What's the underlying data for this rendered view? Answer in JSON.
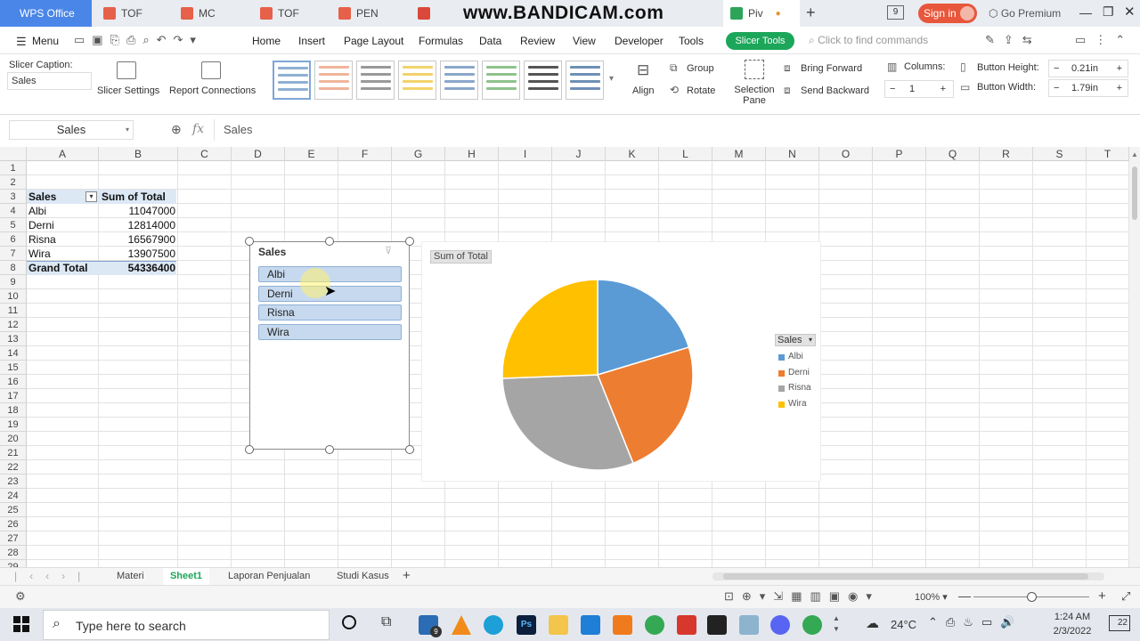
{
  "watermark": "www.BANDICAM.com",
  "tabs": {
    "wps": "WPS Office",
    "docs": [
      "TOF",
      "MC",
      "TOF",
      "PEN",
      "",
      "Piv"
    ],
    "active": "Piv",
    "sign_in": "Sign in",
    "premium": "Go Premium",
    "badge": "9"
  },
  "menu": {
    "menu_label": "Menu",
    "items": [
      "Home",
      "Insert",
      "Page Layout",
      "Formulas",
      "Data",
      "Review",
      "View",
      "Developer",
      "Tools"
    ],
    "active_tool": "Slicer Tools",
    "search_placeholder": "Click to find commands"
  },
  "ribbon": {
    "caption_label": "Slicer Caption:",
    "caption_value": "Sales",
    "slicer_settings": "Slicer Settings",
    "report_connections": "Report Connections",
    "align": "Align",
    "group": "Group",
    "rotate": "Rotate",
    "selection_pane": "Selection Pane",
    "bring_forward": "Bring Forward",
    "send_backward": "Send Backward",
    "columns_label": "Columns:",
    "columns_value": "1",
    "button_height_label": "Button Height:",
    "button_height_value": "0.21in",
    "button_width_label": "Button Width:",
    "button_width_value": "1.79in"
  },
  "formula_bar": {
    "name_box": "Sales",
    "fx": "fx",
    "content": "Sales"
  },
  "columns": [
    "A",
    "B",
    "C",
    "D",
    "E",
    "F",
    "G",
    "H",
    "I",
    "J",
    "K",
    "L",
    "M",
    "N",
    "O",
    "P",
    "Q",
    "R",
    "S",
    "T"
  ],
  "rows": [
    "1",
    "2",
    "3",
    "4",
    "5",
    "6",
    "7",
    "8",
    "9",
    "10",
    "11",
    "12",
    "13",
    "14",
    "15",
    "16",
    "17",
    "18",
    "19",
    "20",
    "21",
    "22",
    "23",
    "24",
    "25",
    "26",
    "27",
    "28",
    "29"
  ],
  "pivot": {
    "header_a": "Sales",
    "header_b": "Sum of Total",
    "rows": [
      {
        "name": "Albi",
        "value": "11047000"
      },
      {
        "name": "Derni",
        "value": "12814000"
      },
      {
        "name": "Risna",
        "value": "16567900"
      },
      {
        "name": "Wira",
        "value": "13907500"
      }
    ],
    "total_label": "Grand Total",
    "total_value": "54336400"
  },
  "slicer": {
    "title": "Sales",
    "items": [
      "Albi",
      "Derni",
      "Risna",
      "Wira"
    ]
  },
  "chart_data": {
    "type": "pie",
    "title": "",
    "field_button": "Sum of Total",
    "legend_title": "Sales",
    "legend_position": "right",
    "categories": [
      "Albi",
      "Derni",
      "Risna",
      "Wira"
    ],
    "values": [
      11047000,
      12814000,
      16567900,
      13907500
    ],
    "colors": [
      "#5b9bd5",
      "#ed7d31",
      "#a5a5a5",
      "#ffc000"
    ]
  },
  "sheets": {
    "tabs": [
      "Materi",
      "Sheet1",
      "Laporan Penjualan",
      "Studi Kasus"
    ],
    "active": "Sheet1",
    "add": "+"
  },
  "status": {
    "zoom": "100%"
  },
  "taskbar": {
    "search_placeholder": "Type here to search",
    "temperature": "24°C",
    "time": "1:24 AM",
    "date": "2/3/2022",
    "notification_count": "22",
    "mail_badge": "9"
  }
}
